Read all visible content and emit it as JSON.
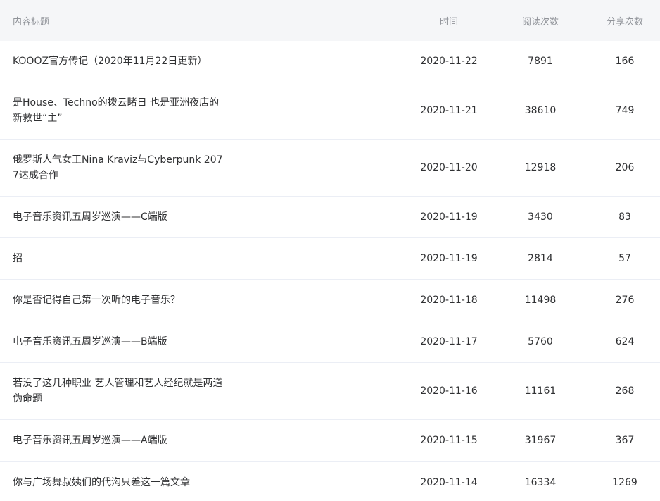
{
  "table": {
    "headers": {
      "title": "内容标题",
      "date": "时间",
      "reads": "阅读次数",
      "shares": "分享次数"
    },
    "rows": [
      {
        "title": "KOOOZ官方传记（2020年11月22日更新）",
        "date": "2020-11-22",
        "reads": "7891",
        "shares": "166"
      },
      {
        "title": "是House、Techno的拨云睹日 也是亚洲夜店的新救世“主”",
        "date": "2020-11-21",
        "reads": "38610",
        "shares": "749"
      },
      {
        "title": "俄罗斯人气女王Nina Kraviz与Cyberpunk 2077达成合作",
        "date": "2020-11-20",
        "reads": "12918",
        "shares": "206"
      },
      {
        "title": "电子音乐资讯五周岁巡演——C端版",
        "date": "2020-11-19",
        "reads": "3430",
        "shares": "83"
      },
      {
        "title": "招",
        "date": "2020-11-19",
        "reads": "2814",
        "shares": "57"
      },
      {
        "title": "你是否记得自己第一次听的电子音乐？",
        "date": "2020-11-18",
        "reads": "11498",
        "shares": "276"
      },
      {
        "title": "电子音乐资讯五周岁巡演——B端版",
        "date": "2020-11-17",
        "reads": "5760",
        "shares": "624"
      },
      {
        "title": "若没了这几种职业 艺人管理和艺人经纪就是两道伪命题",
        "date": "2020-11-16",
        "reads": "11161",
        "shares": "268"
      },
      {
        "title": "电子音乐资讯五周岁巡演——A端版",
        "date": "2020-11-15",
        "reads": "31967",
        "shares": "367"
      },
      {
        "title": "你与广场舞叔姨们的代沟只差这一篇文章",
        "date": "2020-11-14",
        "reads": "16334",
        "shares": "1269"
      }
    ]
  }
}
